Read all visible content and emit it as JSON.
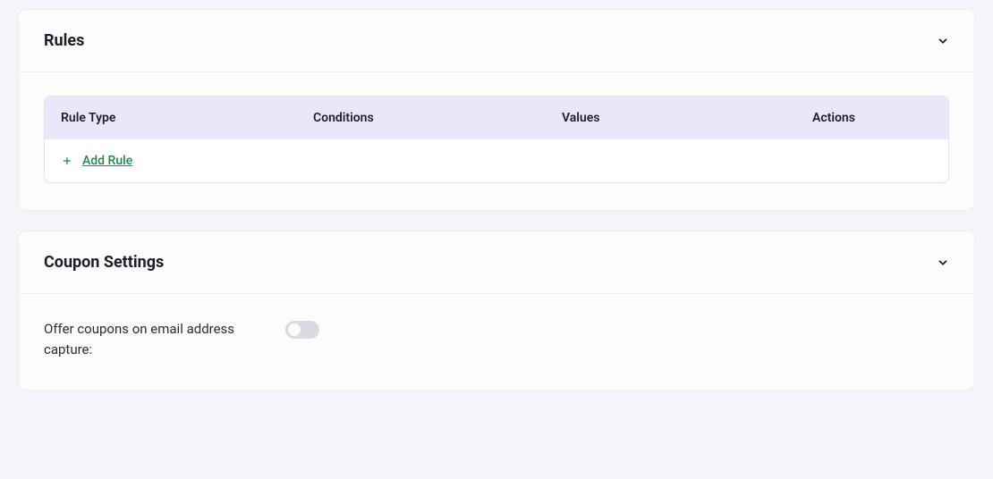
{
  "rules_panel": {
    "title": "Rules",
    "columns": {
      "rule_type": "Rule Type",
      "conditions": "Conditions",
      "values": "Values",
      "actions": "Actions"
    },
    "add_rule_label": "Add Rule"
  },
  "coupon_panel": {
    "title": "Coupon Settings",
    "offer_label": "Offer coupons on email address capture:",
    "offer_enabled": false
  }
}
